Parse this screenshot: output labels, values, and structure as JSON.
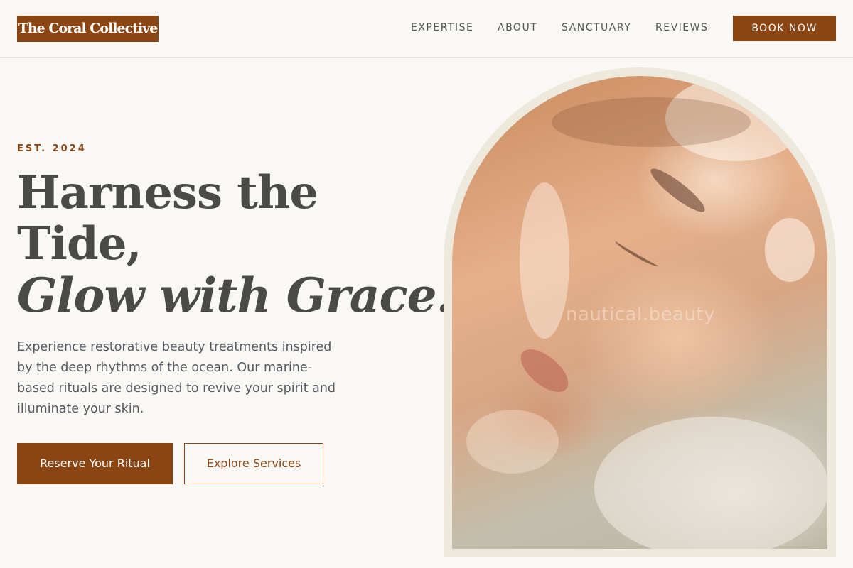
{
  "header": {
    "logo": "The Coral Collective",
    "nav": [
      "EXPERTISE",
      "ABOUT",
      "SANCTUARY",
      "REVIEWS"
    ],
    "cta": "BOOK NOW"
  },
  "hero": {
    "eyebrow": "EST. 2024",
    "headline_line1": "Harness the",
    "headline_line2": "Tide,",
    "headline_line3": "Glow with Grace.",
    "description": "Experience restorative beauty treatments inspired by the deep rhythms of the ocean. Our marine-based rituals are designed to revive your spirit and illuminate your skin.",
    "primary_button": "Reserve Your Ritual",
    "secondary_button": "Explore Services"
  },
  "image": {
    "watermark": "nautical.beauty"
  },
  "colors": {
    "brand": "#8b4513",
    "background": "#f9f8f4",
    "text": "#4a4a48",
    "frame": "#eee9dd"
  }
}
